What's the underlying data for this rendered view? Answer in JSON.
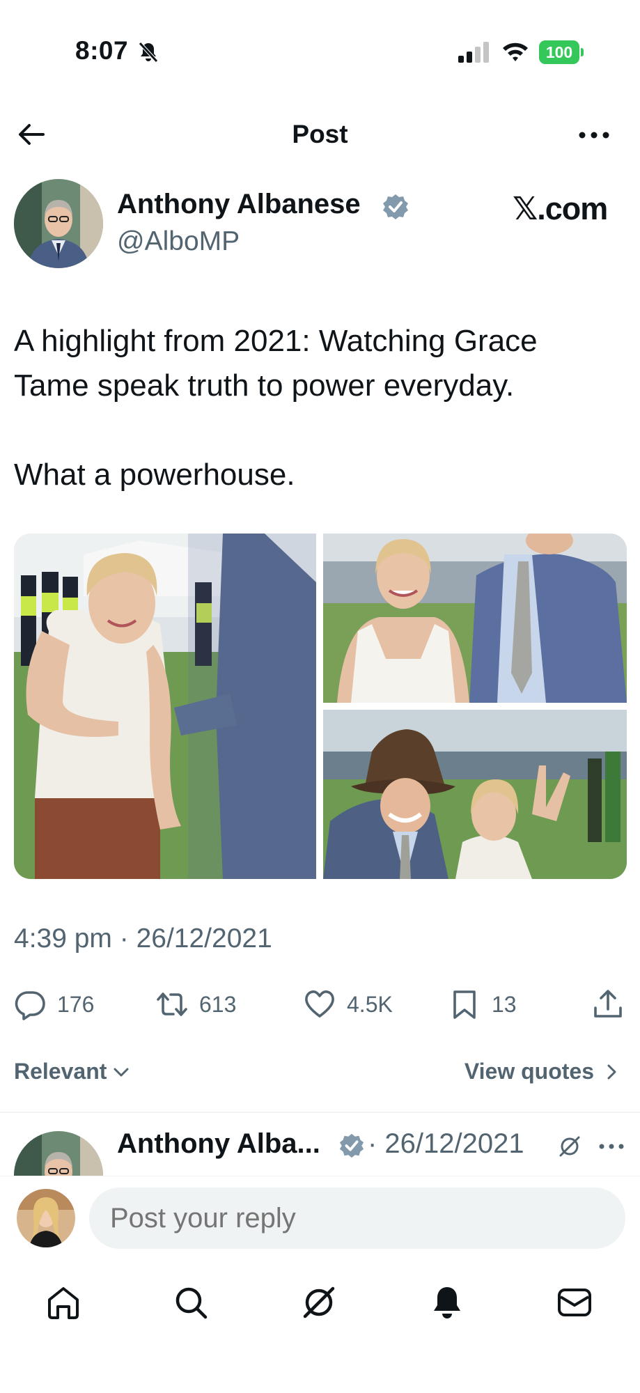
{
  "status_bar": {
    "time": "8:07",
    "battery": "100"
  },
  "header": {
    "title": "Post"
  },
  "author": {
    "name": "Anthony Albanese",
    "handle": "@AlboMP",
    "source": "𝕏.com"
  },
  "tweet": {
    "line1": "A highlight from 2021: Watching Grace",
    "line2": "Tame speak truth to power everyday.",
    "line3": "What a powerhouse.",
    "timestamp": "4:39 pm · 26/12/2021"
  },
  "actions": {
    "replies": "176",
    "reposts": "613",
    "likes": "4.5K",
    "bookmarks": "13"
  },
  "sort": {
    "relevant_label": "Relevant",
    "view_quotes_label": "View quotes"
  },
  "reply_preview": {
    "name": "Anthony Alba...",
    "date": "· 26/12/2021"
  },
  "composer": {
    "placeholder": "Post your reply"
  },
  "colors": {
    "text": "#0f1419",
    "secondary": "#536471",
    "verified": "#829aab",
    "battery": "#34c759",
    "input_bg": "#eff3f4"
  },
  "icons": [
    "bell-off-icon",
    "signal-icon",
    "wifi-icon",
    "back-arrow-icon",
    "more-icon",
    "verified-icon",
    "reply-icon",
    "repost-icon",
    "like-icon",
    "bookmark-icon",
    "share-icon",
    "chevron-down-icon",
    "chevron-right-icon",
    "grok-icon",
    "home-icon",
    "search-icon",
    "notifications-icon",
    "messages-icon"
  ]
}
